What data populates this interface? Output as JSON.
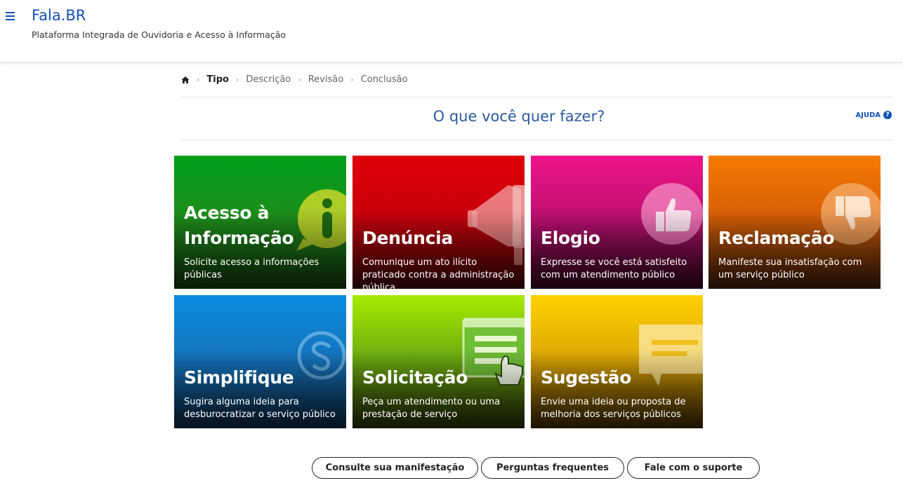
{
  "header": {
    "title": "Fala.BR",
    "subtitle": "Plataforma Integrada de Ouvidoria e Acesso à Informação",
    "menu_icon": "hamburger-menu-icon"
  },
  "breadcrumb": {
    "home_icon": "home-icon",
    "steps": [
      "Tipo",
      "Descrição",
      "Revisão",
      "Conclusão"
    ],
    "active_step": "Tipo"
  },
  "main": {
    "question": "O que você quer fazer?",
    "help_label": "AJUDA",
    "help_icon": "question-circle-icon"
  },
  "cards": [
    {
      "title_line1": "Acesso à",
      "title_line2": "Informação",
      "description": "Solicite acesso a informações públicas",
      "icon": "info-bubble-icon",
      "color": "#009f1a"
    },
    {
      "title": "Denúncia",
      "description": "Comunique um ato ilícito praticado contra a administração pública",
      "icon": "megaphone-icon",
      "color": "#e00008"
    },
    {
      "title": "Elogio",
      "description": "Expresse se você está satisfeito com um atendimento público",
      "icon": "thumbs-up-icon",
      "color": "#f0148a"
    },
    {
      "title": "Reclamação",
      "description": "Manifeste sua insatisfação com um serviço público",
      "icon": "thumbs-down-icon",
      "color": "#f77a00"
    },
    {
      "title": "Simplifique",
      "description": "Sugira alguma ideia para desburocratizar o serviço público",
      "icon": "simplifique-s-icon",
      "color": "#0a8ce0"
    },
    {
      "title": "Solicitação",
      "description": "Peça um atendimento ou uma prestação de serviço",
      "icon": "browser-hand-icon",
      "color": "#a8ea00"
    },
    {
      "title": "Sugestão",
      "description": "Envie uma ideia ou proposta de melhoria dos serviços públicos",
      "icon": "speech-bubble-icon",
      "color": "#ffd200"
    }
  ],
  "footer_buttons": [
    "Consulte sua manifestação",
    "Perguntas frequentes",
    "Fale com o suporte"
  ]
}
